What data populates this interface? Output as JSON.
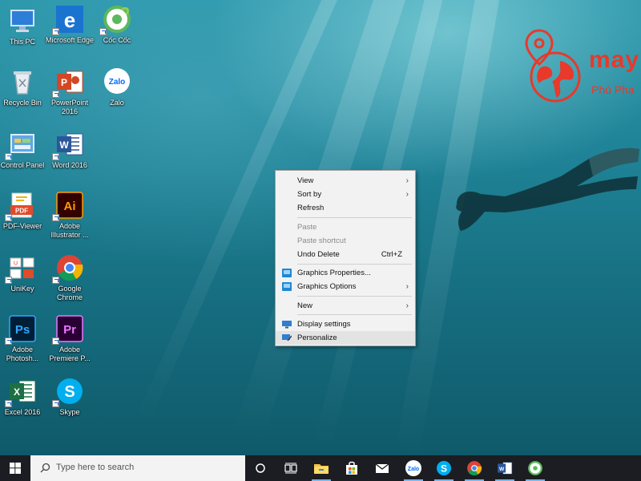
{
  "desktop": {
    "icons": [
      {
        "label": "This PC",
        "icon": "this-pc-icon"
      },
      {
        "label": "Microsoft Edge",
        "icon": "edge-icon"
      },
      {
        "label": "Cốc Cốc",
        "icon": "coccoc-icon"
      },
      {
        "label": "Recycle Bin",
        "icon": "recycle-bin-icon"
      },
      {
        "label": "PowerPoint 2016",
        "icon": "powerpoint-icon"
      },
      {
        "label": "Zalo",
        "icon": "zalo-icon"
      },
      {
        "label": "Control Panel",
        "icon": "control-panel-icon"
      },
      {
        "label": "Word 2016",
        "icon": "word-icon"
      },
      {
        "label": "PDF-Viewer",
        "icon": "pdf-viewer-icon"
      },
      {
        "label": "Adobe Illustrator ...",
        "icon": "illustrator-icon"
      },
      {
        "label": "UniKey",
        "icon": "unikey-icon"
      },
      {
        "label": "Google Chrome",
        "icon": "chrome-icon"
      },
      {
        "label": "Adobe Photosh...",
        "icon": "photoshop-icon"
      },
      {
        "label": "Adobe Premiere P...",
        "icon": "premiere-icon"
      },
      {
        "label": "Excel 2016",
        "icon": "excel-icon"
      },
      {
        "label": "Skype",
        "icon": "skype-icon"
      }
    ],
    "logo": {
      "text": "may",
      "subtext": "Phú Phạ",
      "color": "#e8392a"
    }
  },
  "context_menu": {
    "items": [
      {
        "label": "View",
        "arrow": "›"
      },
      {
        "label": "Sort by",
        "arrow": "›"
      },
      {
        "label": "Refresh"
      },
      {
        "label": "Paste"
      },
      {
        "label": "Paste shortcut"
      },
      {
        "label": "Undo Delete",
        "shortcut": "Ctrl+Z"
      },
      {
        "label": "Graphics Properties..."
      },
      {
        "label": "Graphics Options",
        "arrow": "›"
      },
      {
        "label": "New",
        "arrow": "›"
      },
      {
        "label": "Display settings"
      },
      {
        "label": "Personalize"
      }
    ]
  },
  "taskbar": {
    "search_placeholder": "Type here to search",
    "pinned": [
      "cortana-icon",
      "task-view-icon",
      "file-explorer-icon",
      "store-icon",
      "mail-icon",
      "zalo-icon",
      "skype-icon",
      "chrome-icon",
      "word-icon",
      "coccoc-icon"
    ]
  },
  "colors": {
    "accent": "#0078d7",
    "taskbar": "#1b1d22",
    "menu_bg": "#f2f2f2"
  }
}
